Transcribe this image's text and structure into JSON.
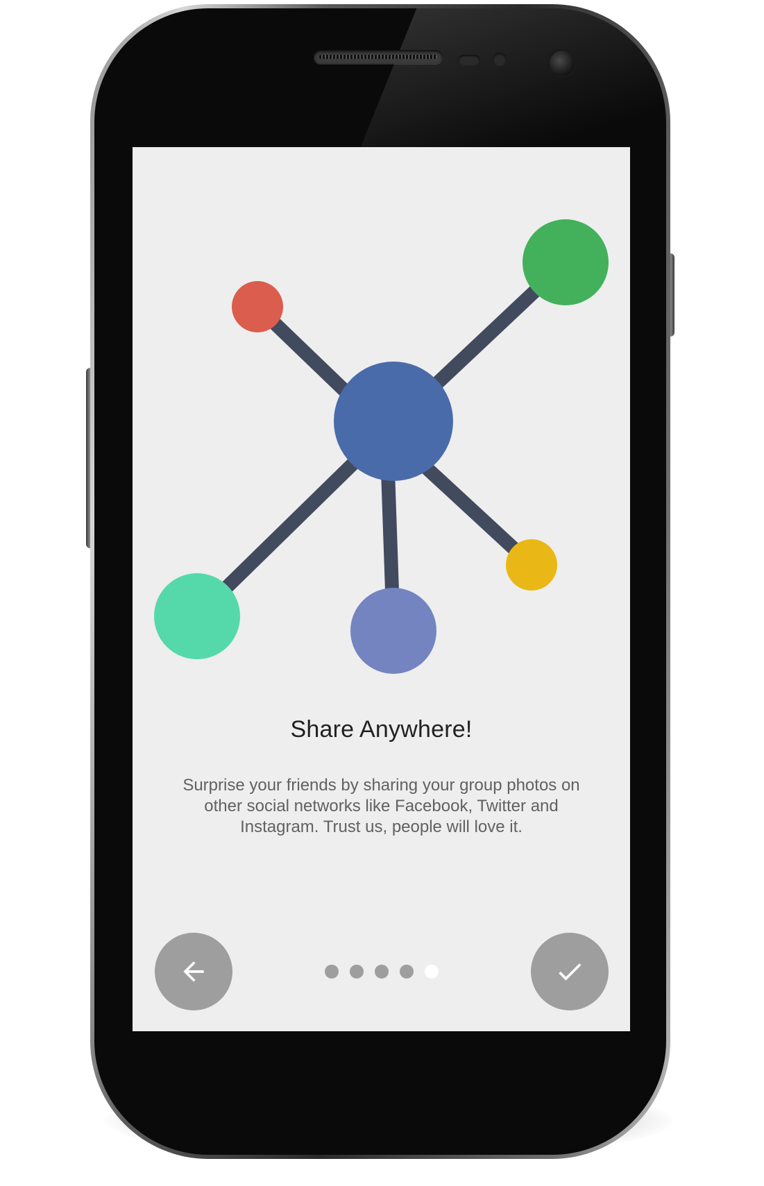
{
  "device": {
    "frame": "android-phone"
  },
  "onboarding": {
    "title": "Share Anywhere!",
    "description": "Surprise your friends by sharing your group photos on other social networks like Facebook, Twitter and Instagram. Trust us, people will love it.",
    "page_count": 5,
    "current_page": 5,
    "back_icon": "arrow-left-icon",
    "done_icon": "check-icon"
  },
  "illustration": {
    "icon": "share-network-icon",
    "colors": {
      "hub": "#4a6ba9",
      "connector": "#424a5e",
      "node_red": "#db5d4d",
      "node_green": "#43b05c",
      "node_teal": "#55d9ab",
      "node_purple": "#7484c0",
      "node_yellow": "#eab816"
    }
  },
  "theme": {
    "screen_background": "#eeeeee",
    "button_color": "#9e9e9e",
    "dot_inactive": "#9e9e9e",
    "dot_active": "#ffffff",
    "title_color": "#212121",
    "body_color": "#616161"
  }
}
